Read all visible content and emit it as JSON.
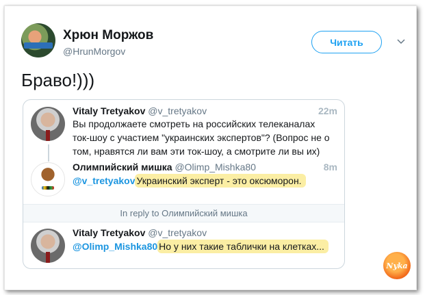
{
  "tweet": {
    "author_name": "Хрюн Моржов",
    "author_handle": "@HrunMorgov",
    "follow_label": "Читать",
    "text": "Браво!)))"
  },
  "quote": {
    "tweet1": {
      "name": "Vitaly Tretyakov",
      "handle": "@v_tretyakov",
      "time": "22m",
      "text": "Вы продолжаете смотреть на российских телеканалах ток-шоу с участием \"украинских экспертов\"? (Вопрос не о том, нравятся ли вам эти ток-шоу, а смотрите ли вы их)"
    },
    "tweet2": {
      "name": "Олимпийский мишка",
      "handle": "@Olimp_Mishka80",
      "time": "8m",
      "mention": "@v_tretyakov",
      "text": "Украинский эксперт - это оксюморон."
    },
    "reply_label": "In reply to Олимпийский мишка",
    "tweet3": {
      "name": "Vitaly Tretyakov",
      "handle": "@v_tretyakov",
      "mention": "@Olimp_Mishka80",
      "text": "Но у них такие таблички на клетках..."
    }
  },
  "watermark": "Nyka",
  "colors": {
    "accent": "#1da1f2",
    "highlight": "#fbeea4",
    "muted": "#657786"
  }
}
